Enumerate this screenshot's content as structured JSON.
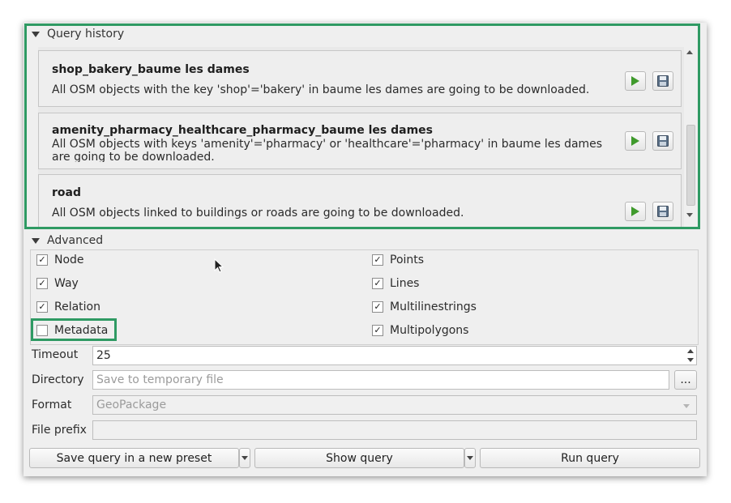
{
  "query_history": {
    "label": "Query history",
    "items": [
      {
        "title": "shop_bakery_baume les dames",
        "description": "All OSM objects with the key 'shop'='bakery' in baume les dames are going to be downloaded."
      },
      {
        "title": "amenity_pharmacy_healthcare_pharmacy_baume les dames",
        "description": "All OSM objects with keys 'amenity'='pharmacy' or 'healthcare'='pharmacy' in baume les dames are going to be downloaded."
      },
      {
        "title": "road",
        "description": "All OSM objects linked to buildings or roads are going to be downloaded."
      }
    ]
  },
  "advanced": {
    "label": "Advanced",
    "left_checks": [
      {
        "label": "Node",
        "checked": true,
        "mark": "✓"
      },
      {
        "label": "Way",
        "checked": true,
        "mark": "✓"
      },
      {
        "label": "Relation",
        "checked": true,
        "mark": "✓"
      },
      {
        "label": "Metadata",
        "checked": false,
        "mark": ""
      }
    ],
    "right_checks": [
      {
        "label": "Points",
        "checked": true,
        "mark": "✓"
      },
      {
        "label": "Lines",
        "checked": true,
        "mark": "✓"
      },
      {
        "label": "Multilinestrings",
        "checked": true,
        "mark": "✓"
      },
      {
        "label": "Multipolygons",
        "checked": true,
        "mark": "✓"
      }
    ]
  },
  "form": {
    "timeout_label": "Timeout",
    "timeout_value": "25",
    "directory_label": "Directory",
    "directory_placeholder": "Save to temporary file",
    "browse_label": "...",
    "format_label": "Format",
    "format_value": "GeoPackage",
    "prefix_label": "File prefix",
    "prefix_value": ""
  },
  "buttons": {
    "save_preset": "Save query in a new preset",
    "show_query": "Show query",
    "run_query": "Run query"
  },
  "colors": {
    "highlight": "#2f9a63",
    "play": "#3f9a2c",
    "disk": "#5a6f86"
  }
}
